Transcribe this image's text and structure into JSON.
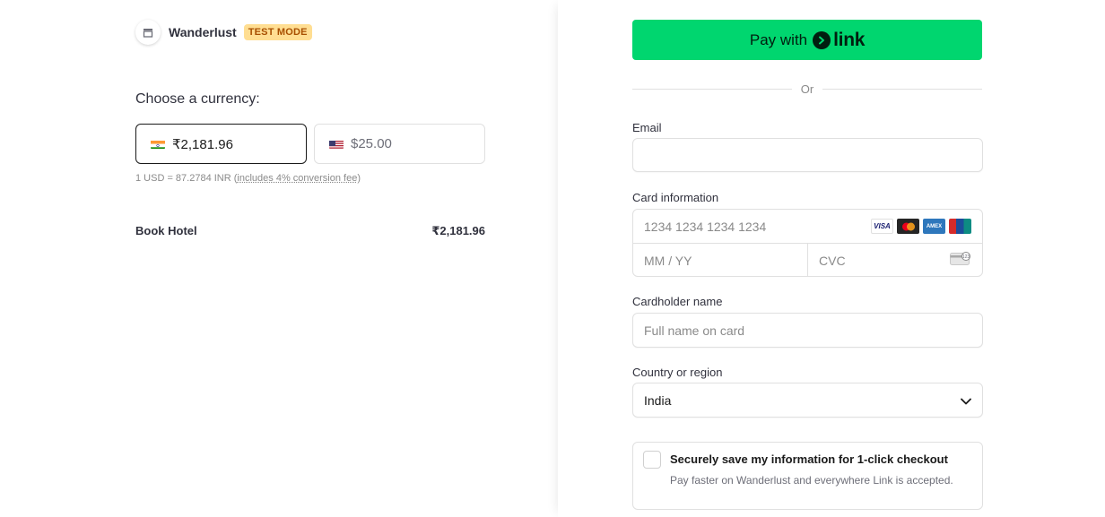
{
  "merchant": {
    "name": "Wanderlust",
    "mode_badge": "TEST MODE",
    "logo_icon": "store-icon"
  },
  "currency": {
    "heading": "Choose a currency:",
    "options": [
      {
        "flag": "india-flag-icon",
        "amount": "₹2,181.96",
        "selected": true
      },
      {
        "flag": "us-flag-icon",
        "amount": "$25.00",
        "selected": false
      }
    ],
    "conversion_prefix": "1 USD = 87.2784 INR (",
    "conversion_link": "includes 4% conversion fee",
    "conversion_suffix": ")"
  },
  "line_item": {
    "name": "Book Hotel",
    "amount": "₹2,181.96"
  },
  "payment": {
    "link_button_prefix": "Pay with",
    "link_button_brand": "link",
    "divider": "Or",
    "email_label": "Email",
    "email_value": "",
    "card_label": "Card information",
    "card_number_placeholder": "1234 1234 1234 1234",
    "card_brands": [
      "VISA",
      "Mastercard",
      "AMEX",
      "UnionPay"
    ],
    "expiry_placeholder": "MM / YY",
    "cvc_placeholder": "CVC",
    "cardholder_label": "Cardholder name",
    "cardholder_placeholder": "Full name on card",
    "country_label": "Country or region",
    "country_value": "India",
    "save_title": "Securely save my information for 1-click checkout",
    "save_desc": "Pay faster on Wanderlust and everywhere Link is accepted."
  },
  "colors": {
    "link_green": "#00d66f",
    "badge_bg": "#ffde92",
    "badge_text": "#a84f00"
  }
}
